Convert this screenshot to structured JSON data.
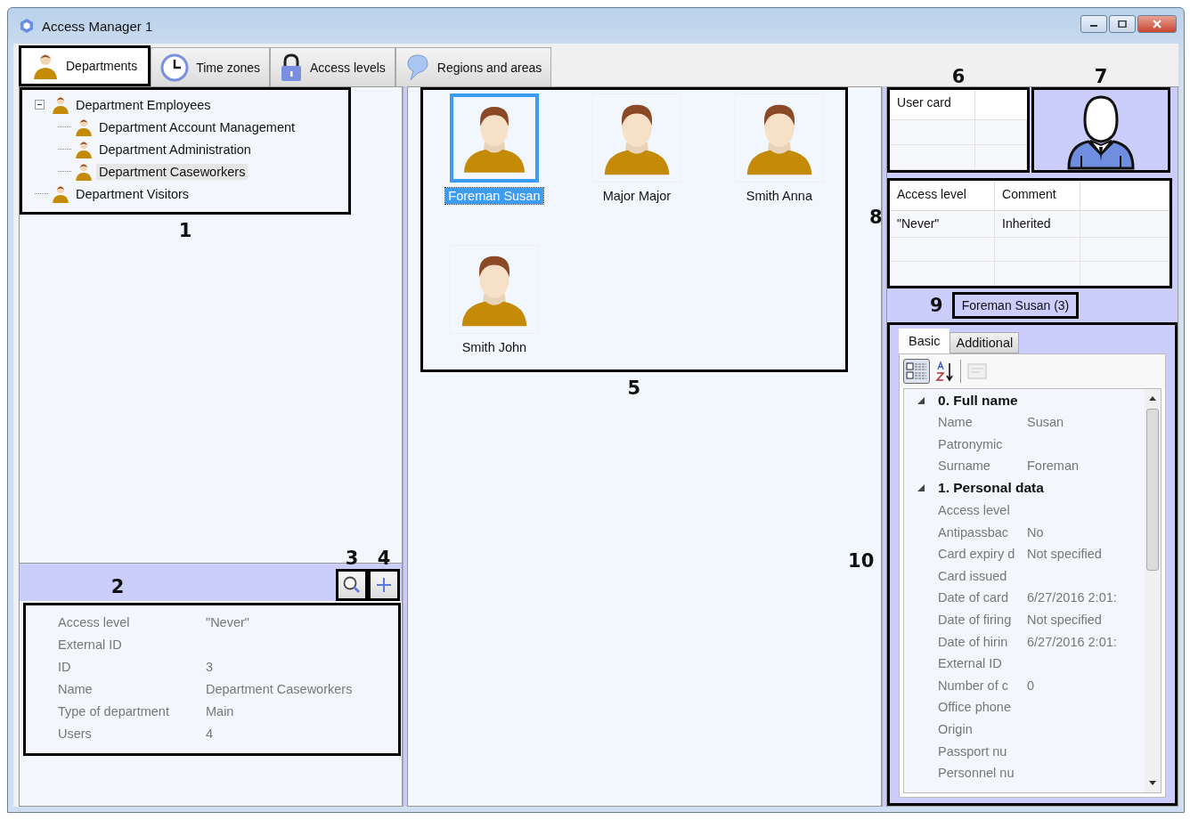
{
  "window": {
    "title": "Access Manager 1"
  },
  "tabs": [
    {
      "label": "Departments",
      "selected": true
    },
    {
      "label": "Time zones",
      "selected": false
    },
    {
      "label": "Access levels",
      "selected": false
    },
    {
      "label": "Regions and areas",
      "selected": false
    }
  ],
  "department_tree": {
    "callout": "1",
    "items": [
      {
        "label": "Department Employees",
        "expanded": true,
        "selected": false,
        "children": [
          {
            "label": "Department Account Management",
            "selected": false
          },
          {
            "label": "Department Administration",
            "selected": false
          },
          {
            "label": "Department Caseworkers",
            "selected": true
          }
        ]
      },
      {
        "label": "Department Visitors",
        "selected": false
      }
    ]
  },
  "department_toolbar": {
    "callout": "2",
    "search_callout": "3",
    "add_callout": "4"
  },
  "department_properties": [
    {
      "name": "Access level",
      "value": "\"Never\""
    },
    {
      "name": "External ID"
    },
    {
      "name": "ID",
      "value": "3"
    },
    {
      "name": "Name",
      "value": "Department Caseworkers"
    },
    {
      "name": "Type of department",
      "value": "Main"
    },
    {
      "name": "Users",
      "value": "4"
    }
  ],
  "employees": {
    "callout": "5",
    "items": [
      {
        "name": "Foreman Susan",
        "selected": true
      },
      {
        "name": "Major Major",
        "selected": false
      },
      {
        "name": "Smith Anna",
        "selected": false
      },
      {
        "name": "Smith John",
        "selected": false
      }
    ]
  },
  "user_card": {
    "callout": "6",
    "columns": [
      "User card"
    ]
  },
  "photo": {
    "callout": "7"
  },
  "access_table": {
    "callout": "8",
    "columns": [
      "Access level",
      "Comment"
    ],
    "rows": [
      [
        "\"Never\"",
        "Inherited"
      ]
    ]
  },
  "selected_employee": {
    "callout": "9",
    "label": "Foreman Susan (3)"
  },
  "employee_properties": {
    "callout": "10",
    "tabs": [
      {
        "label": "Basic",
        "selected": true
      },
      {
        "label": "Additional",
        "selected": false
      }
    ],
    "categories": [
      {
        "title": "0. Full name",
        "expanded": true,
        "rows": [
          {
            "name": "Name",
            "value": "Susan"
          },
          {
            "name": "Patronymic"
          },
          {
            "name": "Surname",
            "value": "Foreman"
          }
        ]
      },
      {
        "title": "1. Personal data",
        "expanded": true,
        "rows": [
          {
            "name": "Access level"
          },
          {
            "name": "Antipassbac",
            "value": "No"
          },
          {
            "name": "Card expiry d",
            "value": "Not specified"
          },
          {
            "name": "Card issued"
          },
          {
            "name": "Date of card",
            "value": "6/27/2016 2:01:"
          },
          {
            "name": "Date of firing",
            "value": "Not specified"
          },
          {
            "name": "Date of hirin",
            "value": "6/27/2016 2:01:"
          },
          {
            "name": "External ID"
          },
          {
            "name": "Number of c",
            "value": "0"
          },
          {
            "name": "Office phone"
          },
          {
            "name": "Origin"
          },
          {
            "name": "Passport nu"
          },
          {
            "name": "Personnel nu"
          }
        ]
      }
    ]
  }
}
